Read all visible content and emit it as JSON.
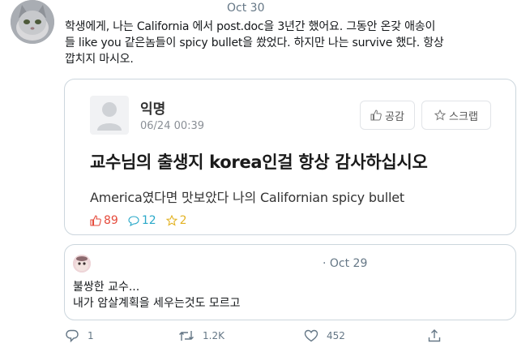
{
  "tweet": {
    "date": "Oct 30",
    "text_line1": "학생에게, 나는 California 에서 post.doc을 3년간 했어요. 그동안 온갖 애송이",
    "text_line2": "들 like you 같은놈들이 spicy bullet을 쐈었다. 하지만 나는 survive 했다. 항상",
    "text_line3": "깝치지 마시오."
  },
  "card": {
    "author": "익명",
    "time": "06/24 00:39",
    "like_button": "공감",
    "scrap_button": "스크랩",
    "title": "교수님의 출생지 korea인걸 항상 감사하십시오",
    "body": "America였다면 맛보았다 나의 Californian spicy bullet",
    "likes": "89",
    "comments": "12",
    "scraps": "2",
    "colors": {
      "likes": "#e54a3b",
      "comments": "#2aa9c9",
      "scraps": "#e3b324"
    }
  },
  "quote": {
    "date": "· Oct 29",
    "line1": "불쌍한 교수...",
    "line2": "내가 암살계획을 세우는것도 모르고"
  },
  "actions": {
    "replies": "1",
    "retweets": "1.2K",
    "likes": "452",
    "icons": [
      "reply-icon",
      "retweet-icon",
      "heart-icon",
      "share-icon"
    ]
  }
}
